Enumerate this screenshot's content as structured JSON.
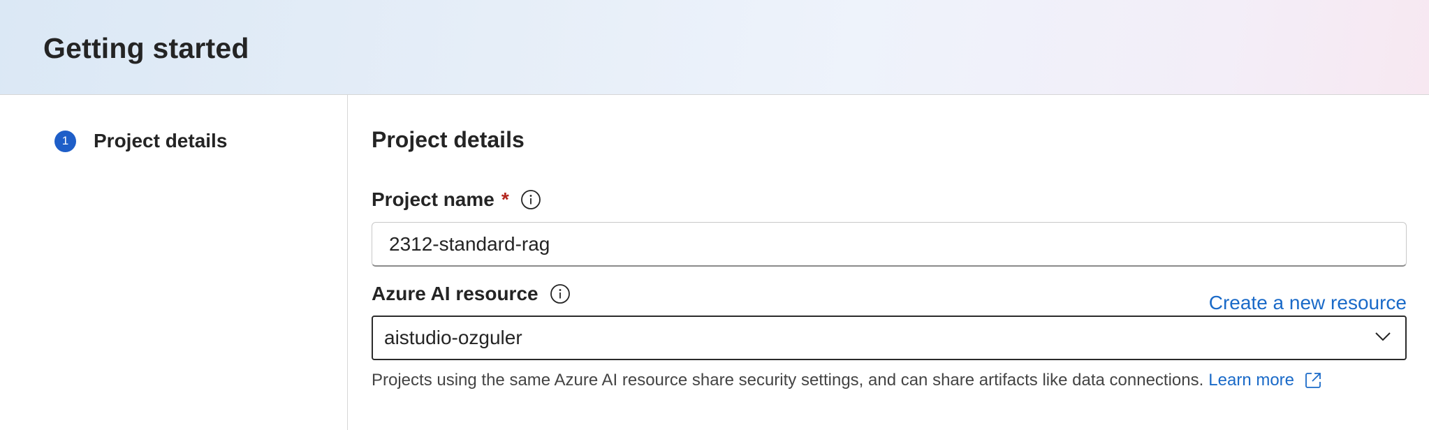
{
  "header": {
    "title": "Getting started"
  },
  "steps": [
    {
      "number": "1",
      "label": "Project details"
    }
  ],
  "main": {
    "section_title": "Project details",
    "project_name": {
      "label": "Project name",
      "required_mark": "*",
      "value": "2312-standard-rag"
    },
    "azure_ai_resource": {
      "label": "Azure AI resource",
      "selected_value": "aistudio-ozguler",
      "create_link": "Create a new resource",
      "help_text": "Projects using the same Azure AI resource share security settings, and can share artifacts like data connections.",
      "learn_more": "Learn more"
    }
  },
  "icons": {
    "info": "info-icon",
    "dropdown": "chevron-down-icon",
    "external_link": "external-link-icon"
  },
  "colors": {
    "accent": "#1e5ec8",
    "link": "#1a6ac8",
    "required": "#b3261e"
  }
}
